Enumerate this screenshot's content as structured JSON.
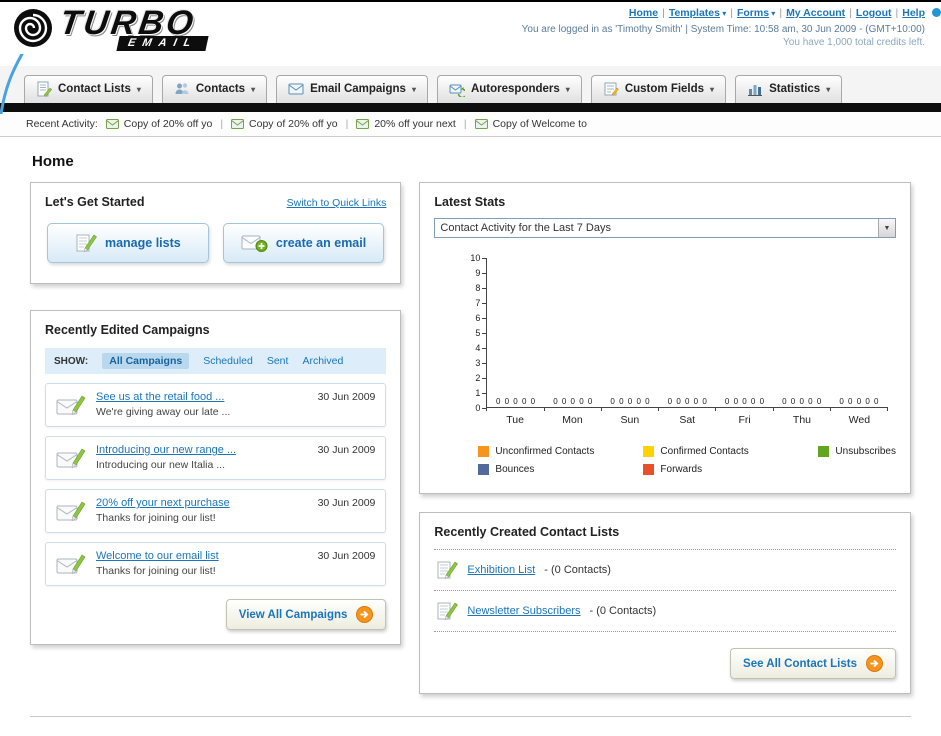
{
  "brand_colors": {
    "link_blue": "#1b75bb",
    "accent_orange": "#f7941d",
    "bar_black": "#0d0d0d"
  },
  "header": {
    "logo": {
      "title": "TURBO",
      "subtitle": "EMAIL"
    },
    "links": [
      {
        "label": "Home",
        "dropdown": false
      },
      {
        "label": "Templates",
        "dropdown": true
      },
      {
        "label": "Forms",
        "dropdown": true
      },
      {
        "label": "My Account",
        "dropdown": false
      },
      {
        "label": "Logout",
        "dropdown": false
      },
      {
        "label": "Help",
        "dropdown": false
      }
    ],
    "login_info": "You are logged in as 'Timothy Smith' | System Time: 10:58 am, 30 Jun 2009 - (GMT+10:00)",
    "credits_info": "You have 1,000 total credits left."
  },
  "nav": {
    "items": [
      {
        "label": "Contact Lists",
        "icon": "contact-lists"
      },
      {
        "label": "Contacts",
        "icon": "contacts"
      },
      {
        "label": "Email Campaigns",
        "icon": "email-campaigns"
      },
      {
        "label": "Autoresponders",
        "icon": "autoresponders"
      },
      {
        "label": "Custom Fields",
        "icon": "custom-fields"
      },
      {
        "label": "Statistics",
        "icon": "statistics"
      }
    ]
  },
  "recent_activity": {
    "label": "Recent Activity:",
    "items": [
      "Copy of 20% off yo",
      "Copy of 20% off yo",
      "20% off your next",
      "Copy of Welcome to"
    ]
  },
  "page_title": "Home",
  "get_started": {
    "title": "Let's Get Started",
    "switch_link": "Switch to Quick Links",
    "buttons": [
      {
        "label": "manage lists"
      },
      {
        "label": "create an email"
      }
    ]
  },
  "campaigns": {
    "title": "Recently Edited Campaigns",
    "show_label": "SHOW:",
    "tabs": [
      "All Campaigns",
      "Scheduled",
      "Sent",
      "Archived"
    ],
    "selected_tab": "All Campaigns",
    "items": [
      {
        "title": "See us at the retail food ...",
        "subtitle": "We're giving away our late ...",
        "date": "30 Jun 2009"
      },
      {
        "title": "Introducing our new range ...",
        "subtitle": "Introducing our new Italia ...",
        "date": "30 Jun 2009"
      },
      {
        "title": "20% off your next purchase",
        "subtitle": "Thanks for joining our list!",
        "date": "30 Jun 2009"
      },
      {
        "title": "Welcome to our email list",
        "subtitle": "Thanks for joining our list!",
        "date": "30 Jun 2009"
      }
    ],
    "view_all_label": "View All Campaigns"
  },
  "stats": {
    "title": "Latest Stats",
    "dropdown_value": "Contact Activity for the Last 7 Days",
    "chart_data": {
      "type": "bar",
      "categories": [
        "Tue",
        "Mon",
        "Sun",
        "Sat",
        "Fri",
        "Thu",
        "Wed"
      ],
      "series": [
        {
          "name": "Unconfirmed Contacts",
          "color": "#f7941d",
          "values": [
            0,
            0,
            0,
            0,
            0,
            0,
            0
          ]
        },
        {
          "name": "Confirmed Contacts",
          "color": "#ffd200",
          "values": [
            0,
            0,
            0,
            0,
            0,
            0,
            0
          ]
        },
        {
          "name": "Unsubscribes",
          "color": "#64a51f",
          "values": [
            0,
            0,
            0,
            0,
            0,
            0,
            0
          ]
        },
        {
          "name": "Bounces",
          "color": "#51699b",
          "values": [
            0,
            0,
            0,
            0,
            0,
            0,
            0
          ]
        },
        {
          "name": "Forwards",
          "color": "#e8502a",
          "values": [
            0,
            0,
            0,
            0,
            0,
            0,
            0
          ]
        }
      ],
      "title": "Contact Activity for the Last 7 Days",
      "xlabel": "",
      "ylabel": "",
      "ylim": [
        0,
        10
      ],
      "grid": false,
      "legend_position": "bottom"
    }
  },
  "contact_lists": {
    "title": "Recently Created Contact Lists",
    "items": [
      {
        "name": "Exhibition List",
        "detail": "- (0 Contacts)"
      },
      {
        "name": "Newsletter Subscribers",
        "detail": "- (0 Contacts)"
      }
    ],
    "see_all_label": "See All Contact Lists"
  }
}
